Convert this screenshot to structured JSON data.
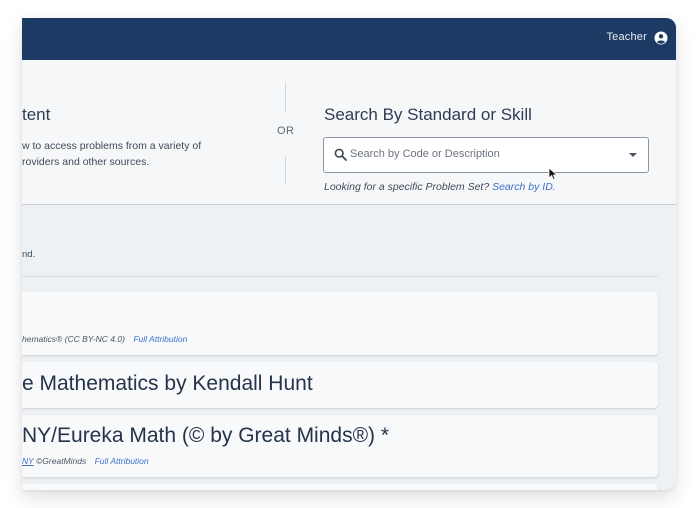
{
  "header": {
    "user_role": "Teacher"
  },
  "browse": {
    "title": "tent",
    "description_line1": "w to access problems from a variety of",
    "description_line2": "roviders and other sources.",
    "or_label": "OR"
  },
  "standard_search": {
    "title": "Search By Standard or Skill",
    "placeholder": "Search by Code or Description",
    "looking_text": "Looking for a specific Problem Set?",
    "search_id_link": "Search by ID."
  },
  "content": {
    "hint": "nd.",
    "cards": [
      {
        "title": "",
        "meta": "hematics® (CC BY-NC 4.0)",
        "attribution_link": "Full Attribution"
      },
      {
        "title": "e Mathematics by Kendall Hunt"
      },
      {
        "title": "NY/Eureka Math (© by Great Minds®) *",
        "meta_link": "NY",
        "meta": "©GreatMinds",
        "attribution_link": "Full Attribution"
      }
    ]
  },
  "colors": {
    "topbar": "#1c3b64",
    "link": "#3c73c7",
    "page_bg": "#eef1f4"
  },
  "icons": [
    "user-circle-icon",
    "search-icon",
    "caret-down-icon",
    "mouse-cursor-icon"
  ]
}
